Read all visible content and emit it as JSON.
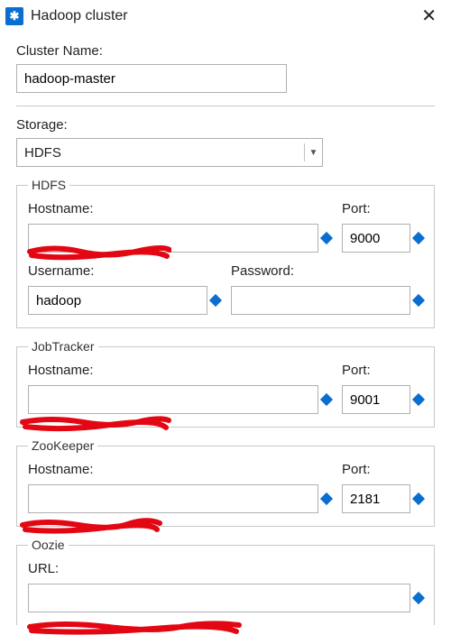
{
  "window": {
    "title": "Hadoop cluster"
  },
  "clusterName": {
    "label": "Cluster Name:",
    "value": "hadoop-master"
  },
  "storage": {
    "label": "Storage:",
    "selected": "HDFS"
  },
  "hdfs": {
    "legend": "HDFS",
    "hostnameLabel": "Hostname:",
    "hostnameValue": "",
    "portLabel": "Port:",
    "portValue": "9000",
    "usernameLabel": "Username:",
    "usernameValue": "hadoop",
    "passwordLabel": "Password:",
    "passwordValue": ""
  },
  "jobTracker": {
    "legend": "JobTracker",
    "hostnameLabel": "Hostname:",
    "hostnameValue": "",
    "portLabel": "Port:",
    "portValue": "9001"
  },
  "zooKeeper": {
    "legend": "ZooKeeper",
    "hostnameLabel": "Hostname:",
    "hostnameValue": "",
    "portLabel": "Port:",
    "portValue": "2181"
  },
  "oozie": {
    "legend": "Oozie",
    "urlLabel": "URL:",
    "urlValue": ""
  }
}
